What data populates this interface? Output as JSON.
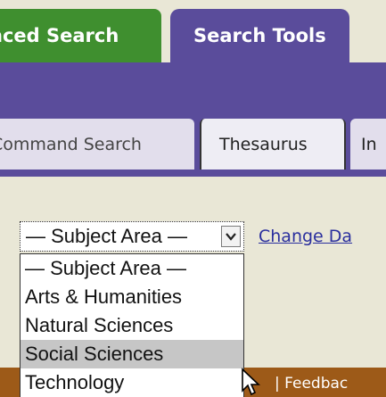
{
  "top_tabs": {
    "advanced_search": "nced Search",
    "search_tools": "Search Tools"
  },
  "sub_tabs": {
    "command_search": "Command Search",
    "thesaurus": "Thesaurus",
    "index": "In"
  },
  "subject_select": {
    "selected": "— Subject Area —",
    "options": [
      "— Subject Area —",
      "Arts & Humanities",
      "Natural Sciences",
      "Social Sciences",
      "Technology"
    ],
    "highlighted_option": "Social Sciences"
  },
  "change_link": "Change Da",
  "footer": {
    "feedback": "| Feedbac"
  },
  "colors": {
    "tab_green": "#3f8f2f",
    "tab_purple": "#5a4c9b",
    "page_bg": "#e9e7d6",
    "footer_brown": "#9d5a18",
    "link_blue": "#2a2f9e"
  }
}
